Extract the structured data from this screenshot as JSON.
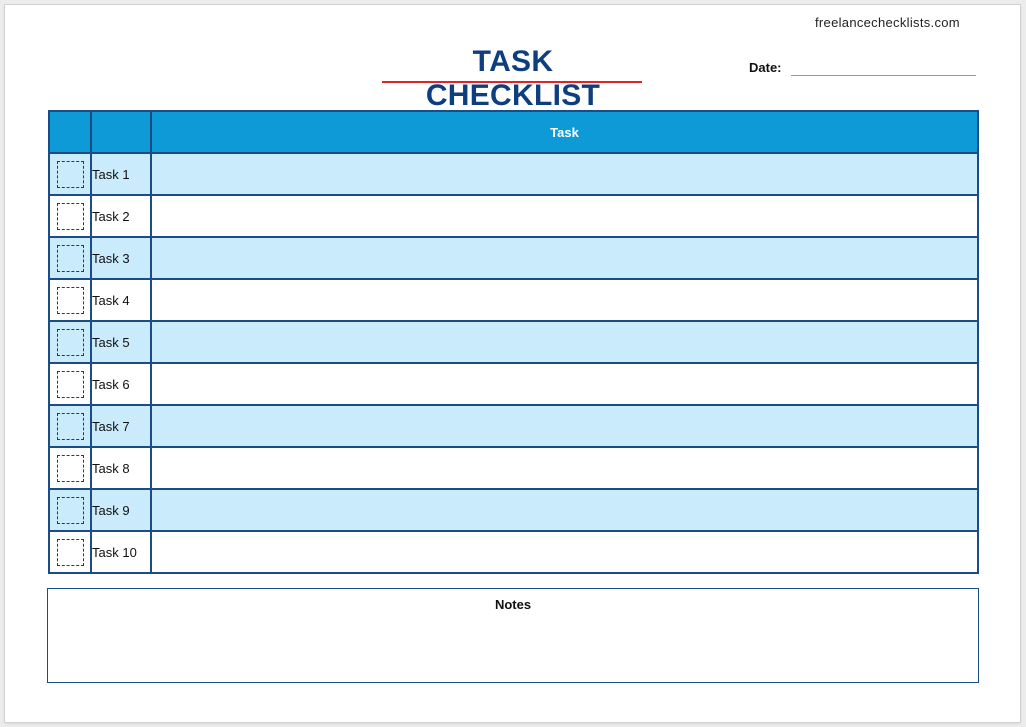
{
  "header": {
    "website": "freelancechecklists.com",
    "title": "TASK CHECKLIST",
    "date_label": "Date:",
    "date_value": ""
  },
  "table": {
    "column_headers": [
      "",
      "",
      "Task"
    ],
    "rows": [
      {
        "label": "Task 1",
        "checked": false,
        "text": ""
      },
      {
        "label": "Task 2",
        "checked": false,
        "text": ""
      },
      {
        "label": "Task 3",
        "checked": false,
        "text": ""
      },
      {
        "label": "Task 4",
        "checked": false,
        "text": ""
      },
      {
        "label": "Task 5",
        "checked": false,
        "text": ""
      },
      {
        "label": "Task 6",
        "checked": false,
        "text": ""
      },
      {
        "label": "Task 7",
        "checked": false,
        "text": ""
      },
      {
        "label": "Task 8",
        "checked": false,
        "text": ""
      },
      {
        "label": "Task 9",
        "checked": false,
        "text": ""
      },
      {
        "label": "Task 10",
        "checked": false,
        "text": ""
      }
    ]
  },
  "notes": {
    "title": "Notes",
    "text": ""
  },
  "colors": {
    "title": "#0d3f7f",
    "title_underline": "#e3232a",
    "header_fill": "#0e9ad6",
    "row_shade": "#c9ebfb",
    "border": "#1b4c86"
  },
  "icons": {
    "checkbox": "dashed-checkbox-icon"
  }
}
